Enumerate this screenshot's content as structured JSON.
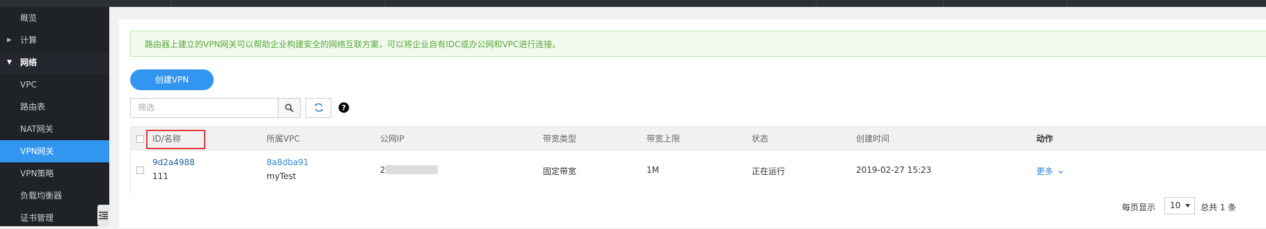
{
  "sidebar": {
    "items": [
      {
        "label": "概览"
      },
      {
        "label": "计算"
      },
      {
        "label": "网络"
      },
      {
        "label": "VPC"
      },
      {
        "label": "路由表"
      },
      {
        "label": "NAT网关"
      },
      {
        "label": "VPN网关"
      },
      {
        "label": "VPN策略"
      },
      {
        "label": "负载均衡器"
      },
      {
        "label": "证书管理"
      }
    ]
  },
  "notice": {
    "text": "路由器上建立的VPN网关可以帮助企业构建安全的网络互联方案，可以将企业自有IDC或办公网和VPC进行连接。"
  },
  "toolbar": {
    "create_label": "创建VPN",
    "filter_placeholder": "筛选"
  },
  "table": {
    "headers": {
      "id_name": "ID/名称",
      "vpc": "所属VPC",
      "public_ip": "公网IP",
      "bandwidth_type": "带宽类型",
      "bandwidth_limit": "带宽上限",
      "status": "状态",
      "created": "创建时间",
      "action": "动作"
    },
    "rows": [
      {
        "id": "9d2a4988",
        "name": "111",
        "vpc_id": "8a8dba91",
        "vpc_name": "myTest",
        "public_ip_prefix": "2",
        "bandwidth_type": "固定带宽",
        "bandwidth_limit": "1M",
        "status": "正在运行",
        "created": "2019-02-27 15:23",
        "action": "更多"
      }
    ]
  },
  "pagination": {
    "per_page_label": "每页显示",
    "per_page_value": "10",
    "total_label": "总共 1 条"
  },
  "colors": {
    "accent": "#3296f0",
    "sidebar_bg": "#1f2227",
    "notice_text": "#56a83a",
    "link": "#3088d8",
    "highlight": "#e03a3a"
  }
}
